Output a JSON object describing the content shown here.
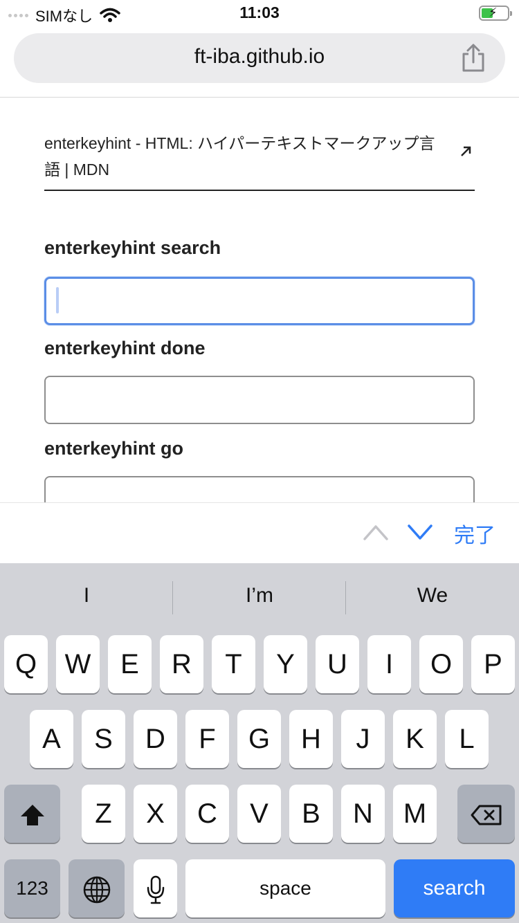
{
  "status_bar": {
    "carrier": "SIMなし",
    "time": "11:03"
  },
  "browser": {
    "url": "ft-iba.github.io",
    "share_icon": "share-icon"
  },
  "page": {
    "mdn_link_text": "enterkeyhint - HTML: ハイパーテキストマークアップ言語 | MDN",
    "fields": [
      {
        "label": "enterkeyhint search"
      },
      {
        "label": "enterkeyhint done"
      },
      {
        "label": "enterkeyhint go"
      }
    ]
  },
  "accessory": {
    "done_label": "完了"
  },
  "keyboard": {
    "suggestions": [
      "I",
      "I’m",
      "We"
    ],
    "row1": [
      "Q",
      "W",
      "E",
      "R",
      "T",
      "Y",
      "U",
      "I",
      "O",
      "P"
    ],
    "row2": [
      "A",
      "S",
      "D",
      "F",
      "G",
      "H",
      "J",
      "K",
      "L"
    ],
    "row3": [
      "Z",
      "X",
      "C",
      "V",
      "B",
      "N",
      "M"
    ],
    "numbers_label": "123",
    "space_label": "space",
    "return_label": "search"
  },
  "colors": {
    "accent": "#2f7cf6",
    "keyboard_bg": "#d2d3d8",
    "battery": "#3dc24a"
  }
}
